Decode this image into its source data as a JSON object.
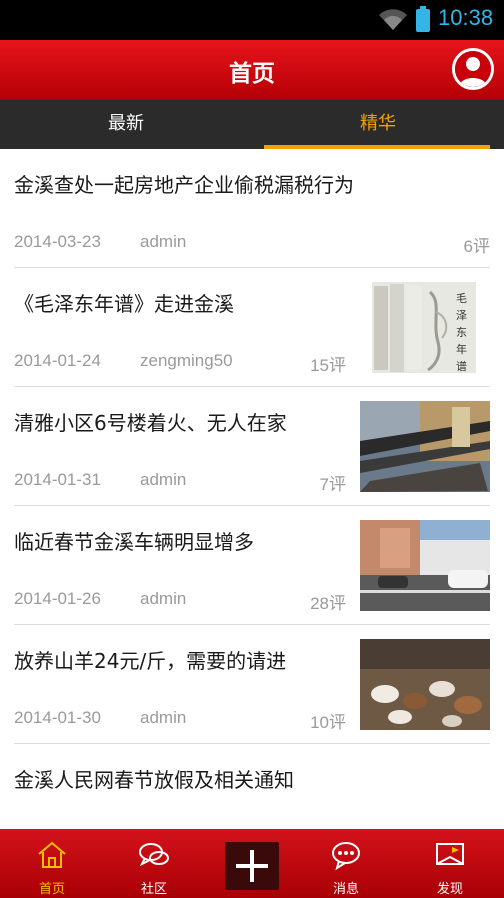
{
  "status_bar": {
    "time": "10:38",
    "icons": [
      "wifi-icon",
      "battery-icon"
    ]
  },
  "header": {
    "title": "首页",
    "user_icon": "user-avatar-icon"
  },
  "tabs": [
    {
      "label": "最新",
      "active": false
    },
    {
      "label": "精华",
      "active": true
    }
  ],
  "articles": [
    {
      "title": "金溪查处一起房地产企业偷税漏税行为",
      "date": "2014-03-23",
      "author": "admin",
      "comments": "6评",
      "has_thumb": false
    },
    {
      "title": "《毛泽东年谱》走进金溪",
      "date": "2014-01-24",
      "author": "zengming50",
      "comments": "15评",
      "has_thumb": true,
      "thumb_caption": "毛泽东年谱"
    },
    {
      "title": "清雅小区6号楼着火、无人在家",
      "date": "2014-01-31",
      "author": "admin",
      "comments": "7评",
      "has_thumb": true
    },
    {
      "title": "临近春节金溪车辆明显增多",
      "date": "2014-01-26",
      "author": "admin",
      "comments": "28评",
      "has_thumb": true
    },
    {
      "title": "放养山羊24元/斤，需要的请进",
      "date": "2014-01-30",
      "author": "admin",
      "comments": "10评",
      "has_thumb": true
    },
    {
      "title": "金溪人民网春节放假及相关通知",
      "date": "",
      "author": "",
      "comments": "",
      "has_thumb": false
    }
  ],
  "bottom_nav": [
    {
      "label": "首页",
      "icon": "home-icon",
      "active": true
    },
    {
      "label": "社区",
      "icon": "chat-bubbles-icon",
      "active": false
    },
    {
      "label": "",
      "icon": "plus-icon",
      "active": false
    },
    {
      "label": "消息",
      "icon": "message-icon",
      "active": false
    },
    {
      "label": "发现",
      "icon": "map-flag-icon",
      "active": false
    }
  ],
  "colors": {
    "brand_red": "#d4121a",
    "accent": "#f5a000",
    "tab_bg": "#2b2b2b",
    "status_blue": "#33b5e5"
  }
}
